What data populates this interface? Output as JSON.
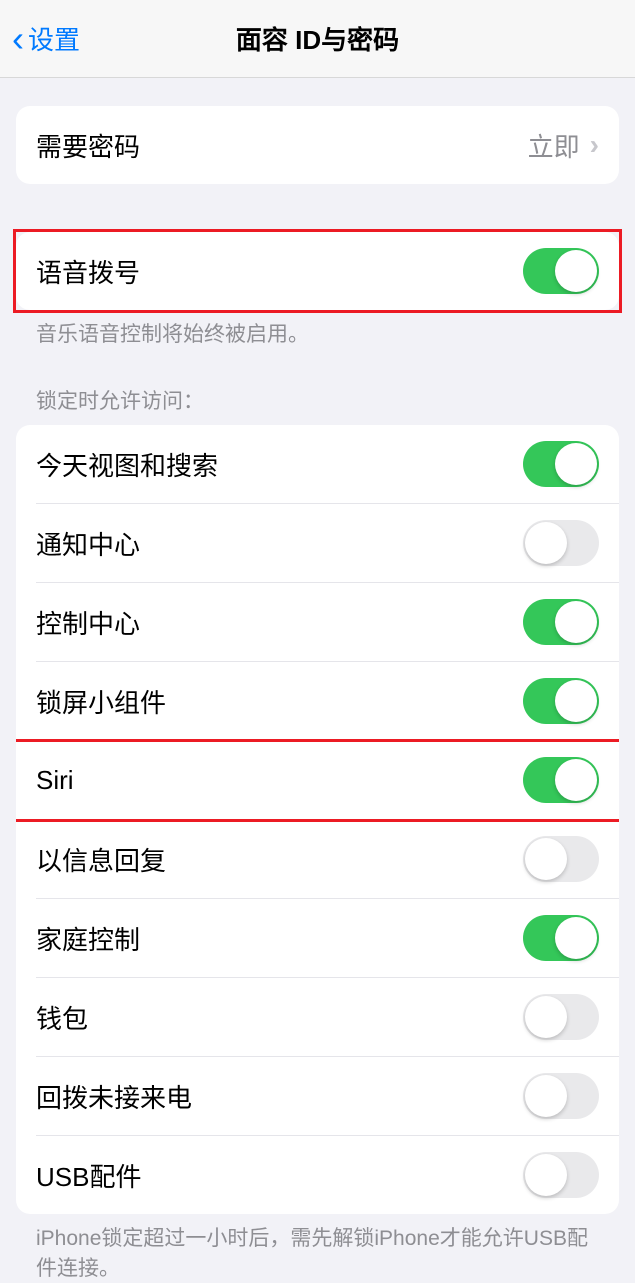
{
  "header": {
    "back_label": "设置",
    "title": "面容 ID与密码"
  },
  "require_passcode": {
    "label": "需要密码",
    "value": "立即"
  },
  "voice_dial": {
    "label": "语音拨号",
    "on": true,
    "footer": "音乐语音控制将始终被启用。"
  },
  "lock_access": {
    "header": "锁定时允许访问：",
    "items": [
      {
        "label": "今天视图和搜索",
        "on": true
      },
      {
        "label": "通知中心",
        "on": false
      },
      {
        "label": "控制中心",
        "on": true
      },
      {
        "label": "锁屏小组件",
        "on": true
      },
      {
        "label": "Siri",
        "on": true
      },
      {
        "label": "以信息回复",
        "on": false
      },
      {
        "label": "家庭控制",
        "on": true
      },
      {
        "label": "钱包",
        "on": false
      },
      {
        "label": "回拨未接来电",
        "on": false
      },
      {
        "label": "USB配件",
        "on": false
      }
    ],
    "footer": "iPhone锁定超过一小时后，需先解锁iPhone才能允许USB配件连接。"
  }
}
